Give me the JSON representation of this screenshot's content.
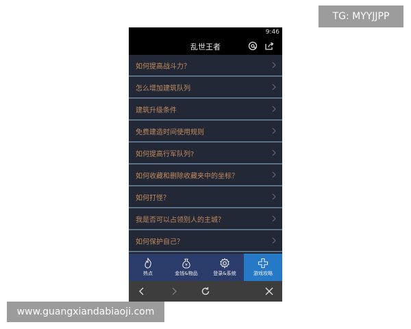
{
  "watermark_top": "TG: MYYJJPP",
  "watermark_bottom": "www.guangxiandabiaoji.com",
  "status": {
    "time": "9:46"
  },
  "header": {
    "title": "乱世王者"
  },
  "list": [
    {
      "label": "如何提高战斗力？"
    },
    {
      "label": "怎么增加建筑队列"
    },
    {
      "label": "建筑升级条件"
    },
    {
      "label": "免费建造时间使用规则"
    },
    {
      "label": "如何提高行军队列?"
    },
    {
      "label": "如何收藏和删除收藏夹中的坐标？"
    },
    {
      "label": "如何打怪？"
    },
    {
      "label": "我是否可以占领别人的主城？"
    },
    {
      "label": "如何保护自己？"
    }
  ],
  "tabs": [
    {
      "label": "热点",
      "icon": "flame-icon"
    },
    {
      "label": "金钱&物品",
      "icon": "money-bag-icon"
    },
    {
      "label": "登录&系统",
      "icon": "gear-icon"
    },
    {
      "label": "游戏攻略",
      "icon": "plus-cross-icon",
      "active": true
    }
  ],
  "colors": {
    "accent": "#2579c6",
    "list_text": "#c18a5c",
    "tab_bg": "#2b3c6b"
  }
}
